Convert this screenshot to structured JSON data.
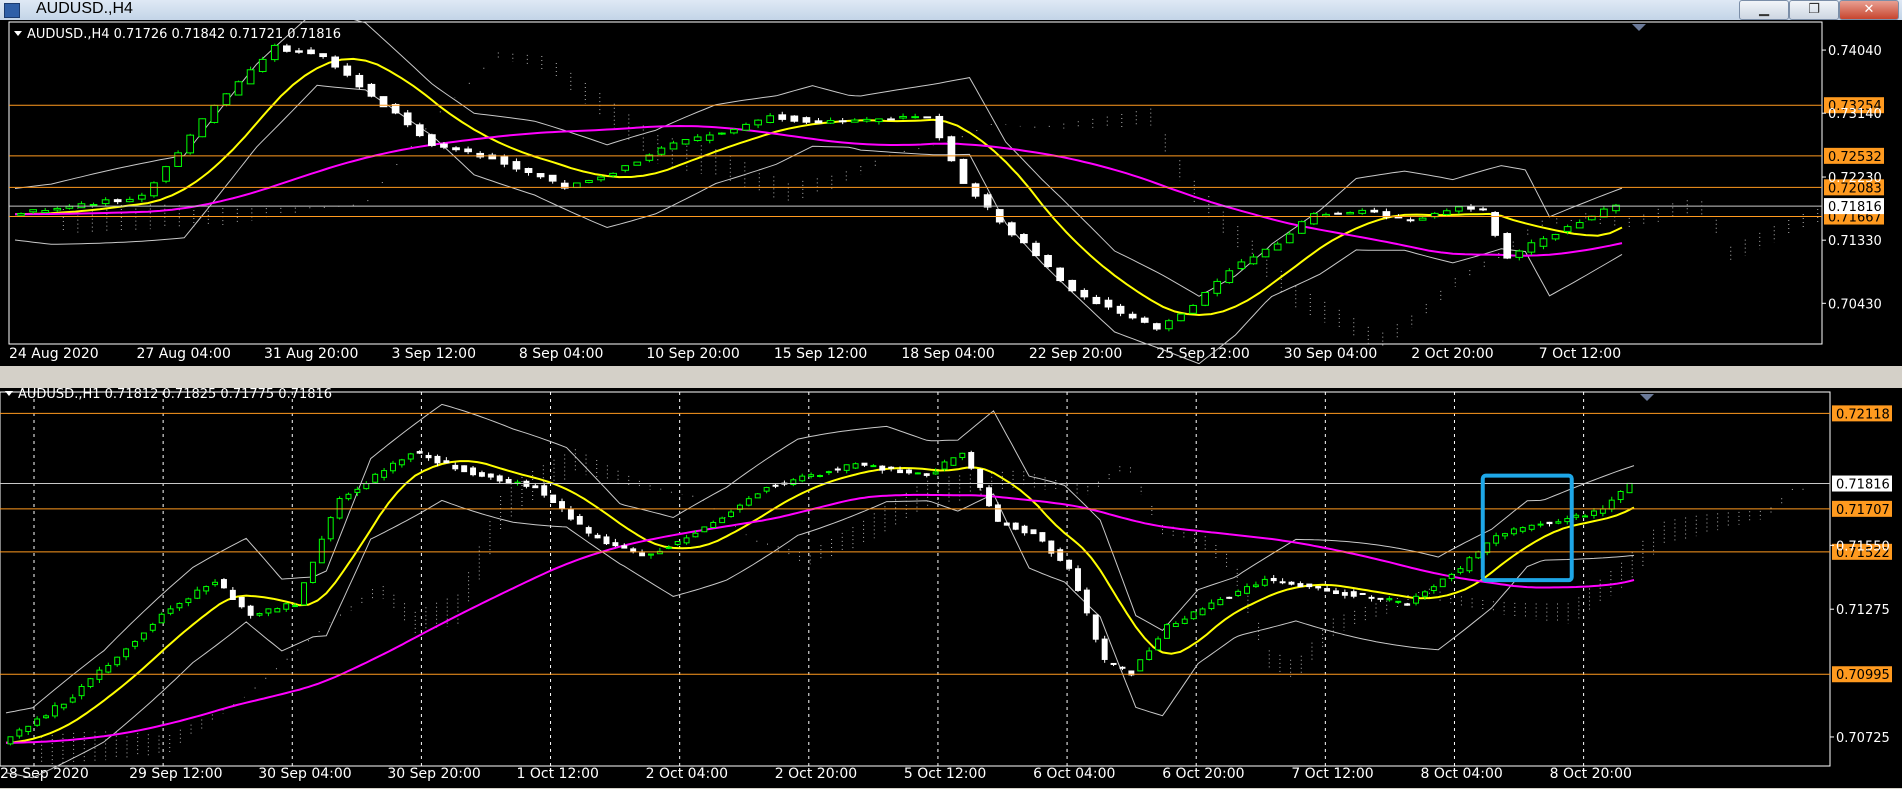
{
  "window": {
    "title": "AUDUSD.,H4",
    "minimize_glyph": "▁",
    "maximize_glyph": "❐",
    "close_glyph": "✕"
  },
  "colors": {
    "background": "#000000",
    "candle_bull": "#00ff00",
    "candle_bear": "#ffffff",
    "ma_fast": "#ffff00",
    "ma_slow": "#ff00ff",
    "bollinger": "#c8c8c8",
    "ichimoku_cloud": "#ffffff",
    "level_line": "#ff9a1f",
    "level_label": "#ff9a1f",
    "current_price_line": "#c8c8c8",
    "highlight_box": "#1ea7e8"
  },
  "chart_data": [
    {
      "type": "candlestick",
      "symbol": "AUDUSD.",
      "timeframe": "H4",
      "header_label": "AUDUSD.,H4  0.71726 0.71842 0.71721 0.71816",
      "last_price": "0.71816",
      "y_ticks": [
        "0.74040",
        "0.73140",
        "0.72230",
        "0.71330",
        "0.70430"
      ],
      "horizontal_levels": [
        "0.73254",
        "0.72532",
        "0.72083",
        "0.71667"
      ],
      "x_labels": [
        "24 Aug 2020",
        "27 Aug 04:00",
        "31 Aug 20:00",
        "3 Sep 12:00",
        "8 Sep 04:00",
        "10 Sep 20:00",
        "15 Sep 12:00",
        "18 Sep 04:00",
        "22 Sep 20:00",
        "25 Sep 12:00",
        "30 Sep 04:00",
        "2 Oct 20:00",
        "7 Oct 12:00"
      ],
      "ylim": [
        0.6985,
        0.7444
      ],
      "price_path": [
        [
          0,
          0.717
        ],
        [
          11,
          0.7195
        ],
        [
          17,
          0.7325
        ],
        [
          22,
          0.7408
        ],
        [
          26,
          0.7395
        ],
        [
          30,
          0.734
        ],
        [
          35,
          0.727
        ],
        [
          40,
          0.725
        ],
        [
          46,
          0.721
        ],
        [
          50,
          0.723
        ],
        [
          55,
          0.727
        ],
        [
          60,
          0.729
        ],
        [
          63,
          0.731
        ],
        [
          67,
          0.73
        ],
        [
          73,
          0.7305
        ],
        [
          76,
          0.731
        ],
        [
          79,
          0.7215
        ],
        [
          82,
          0.716
        ],
        [
          85,
          0.711
        ],
        [
          88,
          0.706
        ],
        [
          92,
          0.703
        ],
        [
          95,
          0.7005
        ],
        [
          98,
          0.704
        ],
        [
          101,
          0.709
        ],
        [
          105,
          0.713
        ],
        [
          108,
          0.717
        ],
        [
          112,
          0.7175
        ],
        [
          116,
          0.716
        ],
        [
          120,
          0.718
        ],
        [
          122,
          0.7175
        ],
        [
          124,
          0.711
        ],
        [
          127,
          0.7135
        ],
        [
          130,
          0.716
        ],
        [
          133,
          0.7182
        ]
      ]
    },
    {
      "type": "candlestick",
      "symbol": "AUDUSD.",
      "timeframe": "H1",
      "header_label": "AUDUSD.,H1  0.71812 0.71825 0.71775 0.71816",
      "last_price": "0.71816",
      "y_ticks": [
        "0.71550",
        "0.71275",
        "0.70725"
      ],
      "horizontal_levels": [
        "0.72118",
        "0.71707",
        "0.71522",
        "0.70995"
      ],
      "x_labels": [
        "28 Sep 2020",
        "29 Sep 12:00",
        "30 Sep 04:00",
        "30 Sep 20:00",
        "1 Oct 12:00",
        "2 Oct 04:00",
        "2 Oct 20:00",
        "5 Oct 12:00",
        "6 Oct 04:00",
        "6 Oct 20:00",
        "7 Oct 12:00",
        "8 Oct 04:00",
        "8 Oct 20:00"
      ],
      "ylim": [
        0.706,
        0.7221
      ],
      "price_path": [
        [
          0,
          0.707
        ],
        [
          8,
          0.709
        ],
        [
          18,
          0.7125
        ],
        [
          24,
          0.714
        ],
        [
          28,
          0.7125
        ],
        [
          33,
          0.713
        ],
        [
          38,
          0.7175
        ],
        [
          46,
          0.7195
        ],
        [
          54,
          0.7185
        ],
        [
          60,
          0.718
        ],
        [
          66,
          0.716
        ],
        [
          72,
          0.715
        ],
        [
          78,
          0.716
        ],
        [
          86,
          0.718
        ],
        [
          96,
          0.719
        ],
        [
          104,
          0.7185
        ],
        [
          108,
          0.7195
        ],
        [
          112,
          0.7165
        ],
        [
          116,
          0.716
        ],
        [
          120,
          0.7145
        ],
        [
          124,
          0.7105
        ],
        [
          127,
          0.71
        ],
        [
          131,
          0.712
        ],
        [
          136,
          0.713
        ],
        [
          142,
          0.714
        ],
        [
          150,
          0.7135
        ],
        [
          158,
          0.713
        ],
        [
          164,
          0.7145
        ],
        [
          168,
          0.716
        ],
        [
          174,
          0.7165
        ],
        [
          180,
          0.717
        ],
        [
          183,
          0.7182
        ]
      ],
      "annotation": {
        "type": "rectangle",
        "x_range": [
          166,
          176
        ],
        "y_range": [
          0.714,
          0.7185
        ]
      }
    }
  ]
}
